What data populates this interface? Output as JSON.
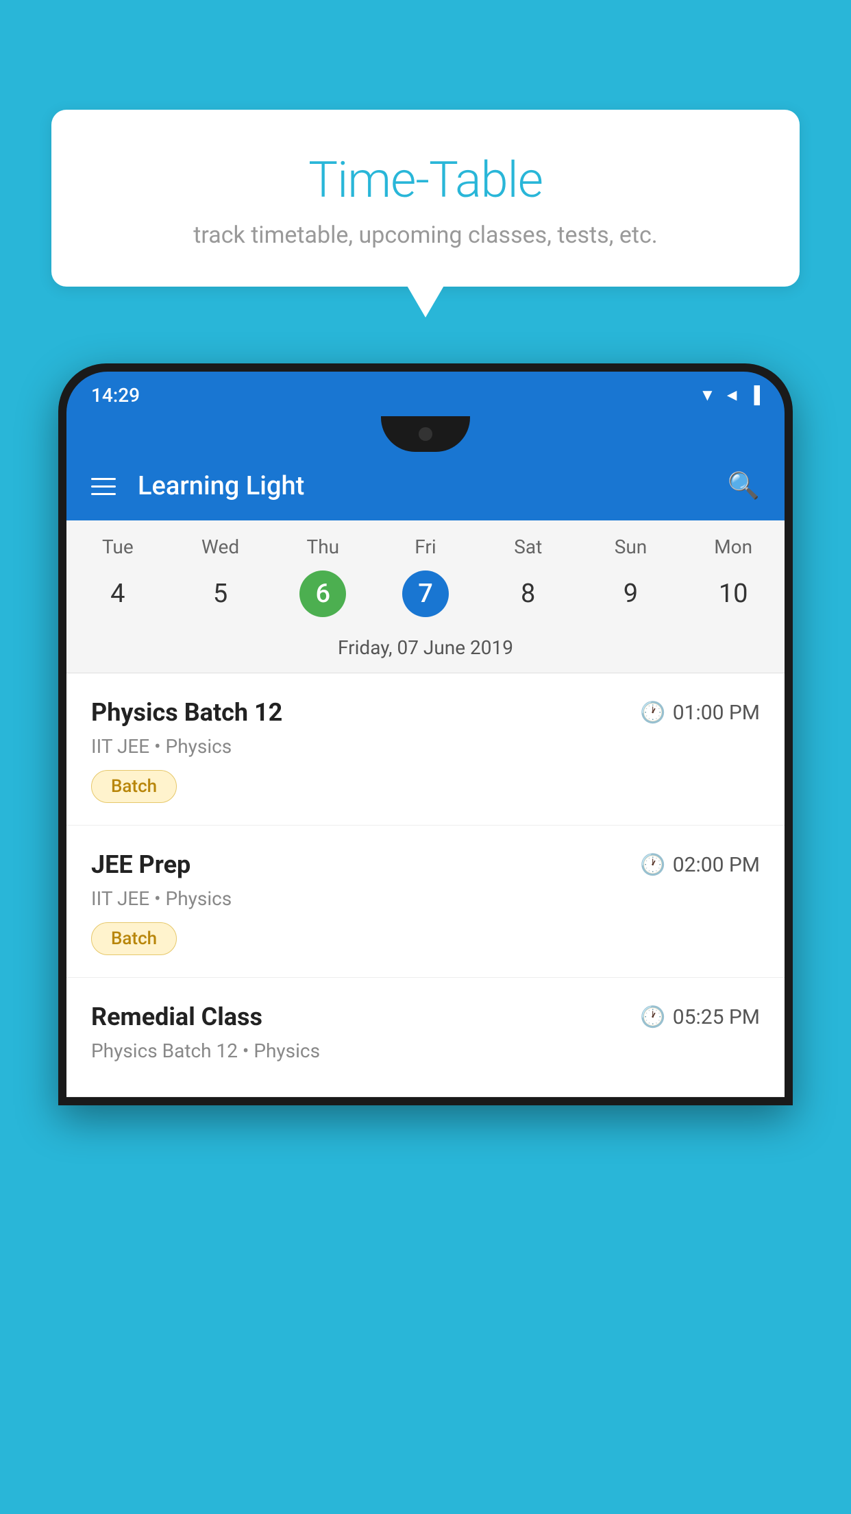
{
  "page": {
    "background_color": "#29b6d8"
  },
  "speech_bubble": {
    "title": "Time-Table",
    "subtitle": "track timetable, upcoming classes, tests, etc."
  },
  "phone": {
    "status_bar": {
      "time": "14:29",
      "icons": [
        "wifi",
        "signal",
        "battery"
      ]
    },
    "app_bar": {
      "title": "Learning Light",
      "menu_icon": "hamburger-icon",
      "search_icon": "search-icon"
    },
    "calendar": {
      "days": [
        {
          "short": "Tue",
          "num": "4"
        },
        {
          "short": "Wed",
          "num": "5"
        },
        {
          "short": "Thu",
          "num": "6",
          "state": "green"
        },
        {
          "short": "Fri",
          "num": "7",
          "state": "blue"
        },
        {
          "short": "Sat",
          "num": "8"
        },
        {
          "short": "Sun",
          "num": "9"
        },
        {
          "short": "Mon",
          "num": "10"
        }
      ],
      "selected_date": "Friday, 07 June 2019"
    },
    "events": [
      {
        "title": "Physics Batch 12",
        "time": "01:00 PM",
        "subtitle": "IIT JEE • Physics",
        "tag": "Batch"
      },
      {
        "title": "JEE Prep",
        "time": "02:00 PM",
        "subtitle": "IIT JEE • Physics",
        "tag": "Batch"
      },
      {
        "title": "Remedial Class",
        "time": "05:25 PM",
        "subtitle": "Physics Batch 12 • Physics",
        "tag": null
      }
    ]
  }
}
